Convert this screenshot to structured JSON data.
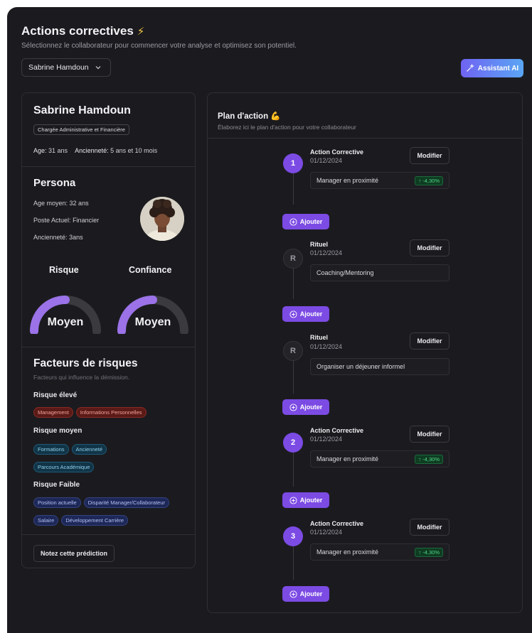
{
  "header": {
    "title": "Actions correctives",
    "bolt_icon": "⚡",
    "subtitle": "Sélectionnez le collaborateur pour commencer votre analyse et optimisez son potentiel.",
    "selected_employee": "Sabrine Hamdoun",
    "assistant_label": "Assistant AI"
  },
  "profile": {
    "name": "Sabrine Hamdoun",
    "role": "Chargée Administrative et  Financière",
    "age_label": "Age:",
    "age_value": "31 ans",
    "seniority_label": "Ancienneté:",
    "seniority_value": "5 ans et 10 mois"
  },
  "persona": {
    "title": "Persona",
    "avg_age_label": "Age moyen:",
    "avg_age_value": "32 ans",
    "position_label": "Poste Actuel:",
    "position_value": "Financier",
    "seniority_label": "Ancienneté:",
    "seniority_value": "3ans",
    "risk_title": "Risque",
    "risk_value": "Moyen",
    "risk_level": 0.5,
    "confidence_title": "Confiance",
    "confidence_value": "Moyen",
    "confidence_level": 0.5
  },
  "factors": {
    "title": "Facteurs de risques",
    "subtitle": "Facteurs qui influence la démission.",
    "high_label": "Risque élevé",
    "high_tags": [
      "Management",
      "Informations Personnelles"
    ],
    "medium_label": "Risque moyen",
    "medium_tags_row1": [
      "Formations",
      "Ancienneté"
    ],
    "medium_tags_row2": [
      "Parcours Académique"
    ],
    "low_label": "Risque Faible",
    "low_tags_row1": [
      "Position actuelle",
      "Disparité Manager/Collaborateur"
    ],
    "low_tags_row2": [
      "Salaire",
      "Développement Carrière"
    ],
    "rate_button": "Notez cette prédiction"
  },
  "plan": {
    "title": "Plan d'action",
    "title_icon": "💪",
    "subtitle": "Élaborez ici le plan d'action pour votre collaborateur",
    "modify_label": "Modifier",
    "add_label": "Ajouter",
    "items": [
      {
        "marker": "1",
        "title": "Action Corrective",
        "date": "01/12/2024",
        "detail": "Manager en proximité",
        "badge": "↑ -4,30%"
      },
      {
        "marker": "R",
        "title": "Rituel",
        "date": "01/12/2024",
        "detail": "Coaching/Mentoring",
        "badge": ""
      },
      {
        "marker": "R",
        "title": "Rituel",
        "date": "01/12/2024",
        "detail": "Organiser un déjeuner informel",
        "badge": ""
      },
      {
        "marker": "2",
        "title": "Action Corrective",
        "date": "01/12/2024",
        "detail": "Manager en proximité",
        "badge": "↑ -4,30%"
      },
      {
        "marker": "3",
        "title": "Action Corrective",
        "date": "01/12/2024",
        "detail": "Manager en proximité",
        "badge": "↑ -4,30%"
      }
    ]
  },
  "colors": {
    "accent": "#7c4be4",
    "gauge_fill": "#9b72e8",
    "gauge_track": "#3a3a3f",
    "positive": "#4fd787",
    "background": "#1b1b1f"
  }
}
